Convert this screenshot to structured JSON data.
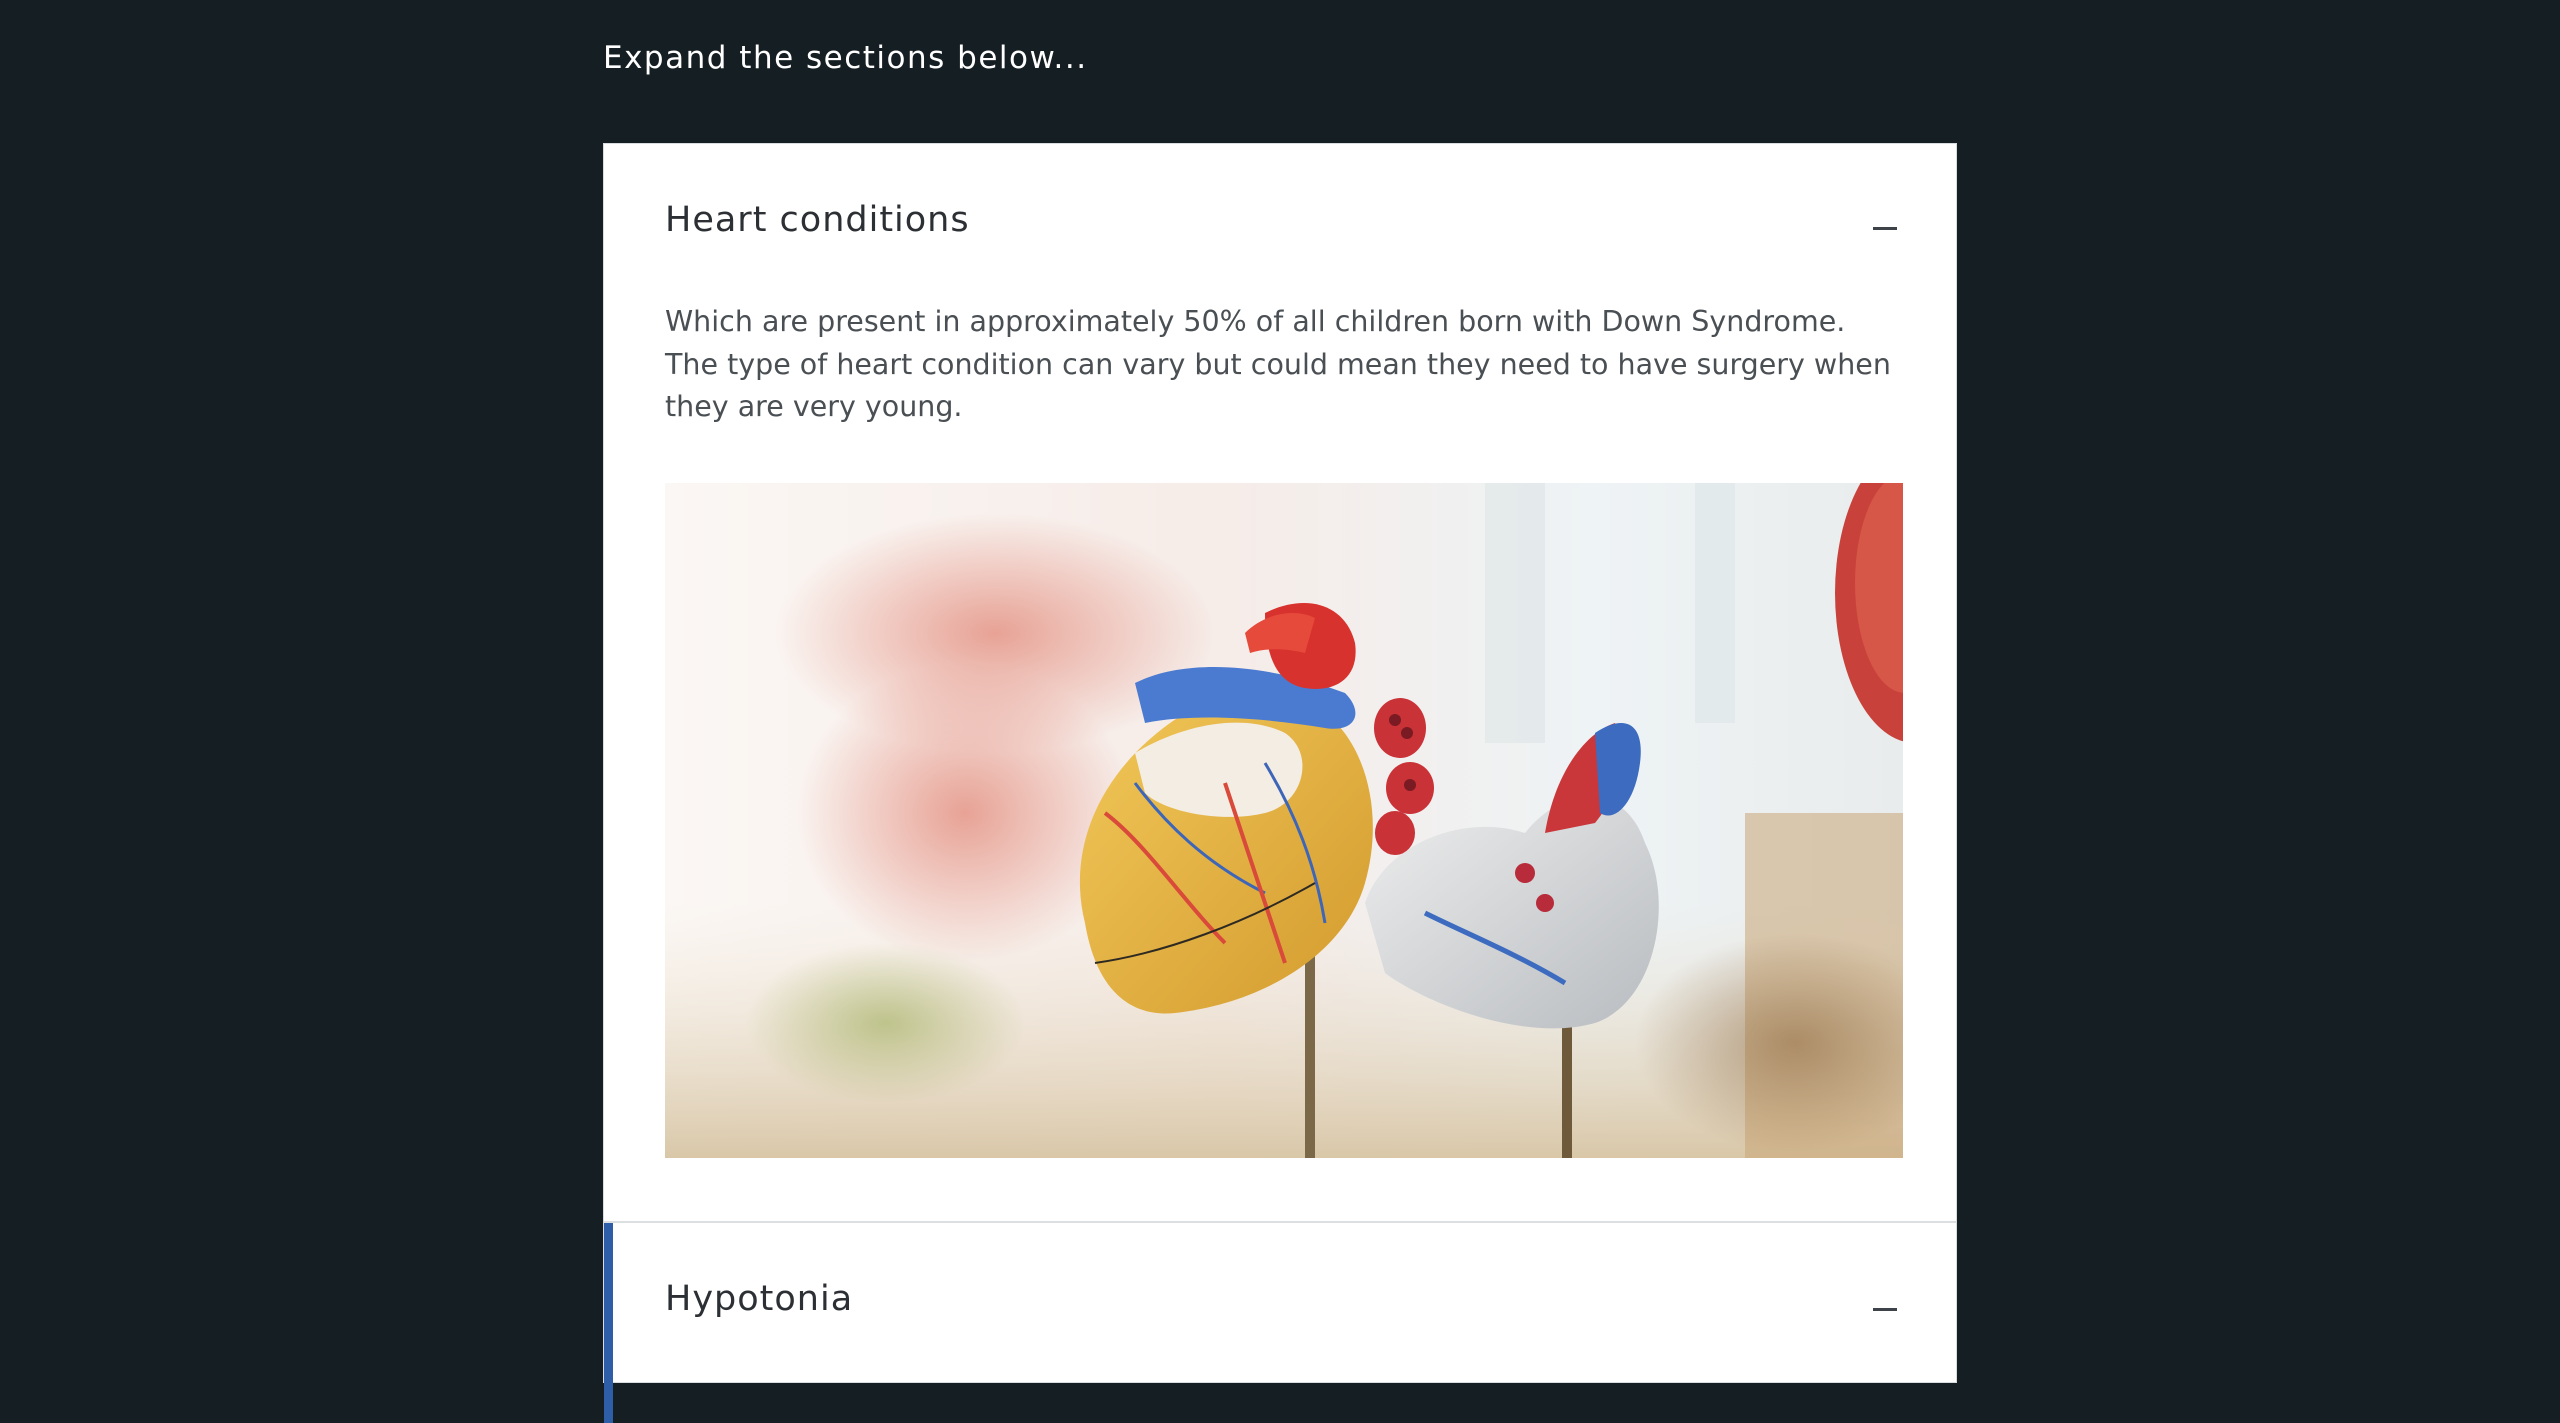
{
  "intro": "Expand the sections below...",
  "accordion": {
    "sections": [
      {
        "title": "Heart conditions",
        "expanded": true,
        "body": "Which are present in approximately 50% of all children born with Down Syndrome. The type of heart condition can vary but could mean they need to have surgery when they are very young.",
        "toggle_icon": "minus-icon",
        "image_subject": ""
      },
      {
        "title": "Hypotonia",
        "expanded": true,
        "toggle_icon": "minus-icon",
        "focused": true
      }
    ]
  },
  "colors": {
    "page_background": "#151e23",
    "card_background": "#ffffff",
    "focus_accent": "#2f5ea8",
    "title_text": "#2c2f33",
    "body_text": "#4a4f54"
  }
}
